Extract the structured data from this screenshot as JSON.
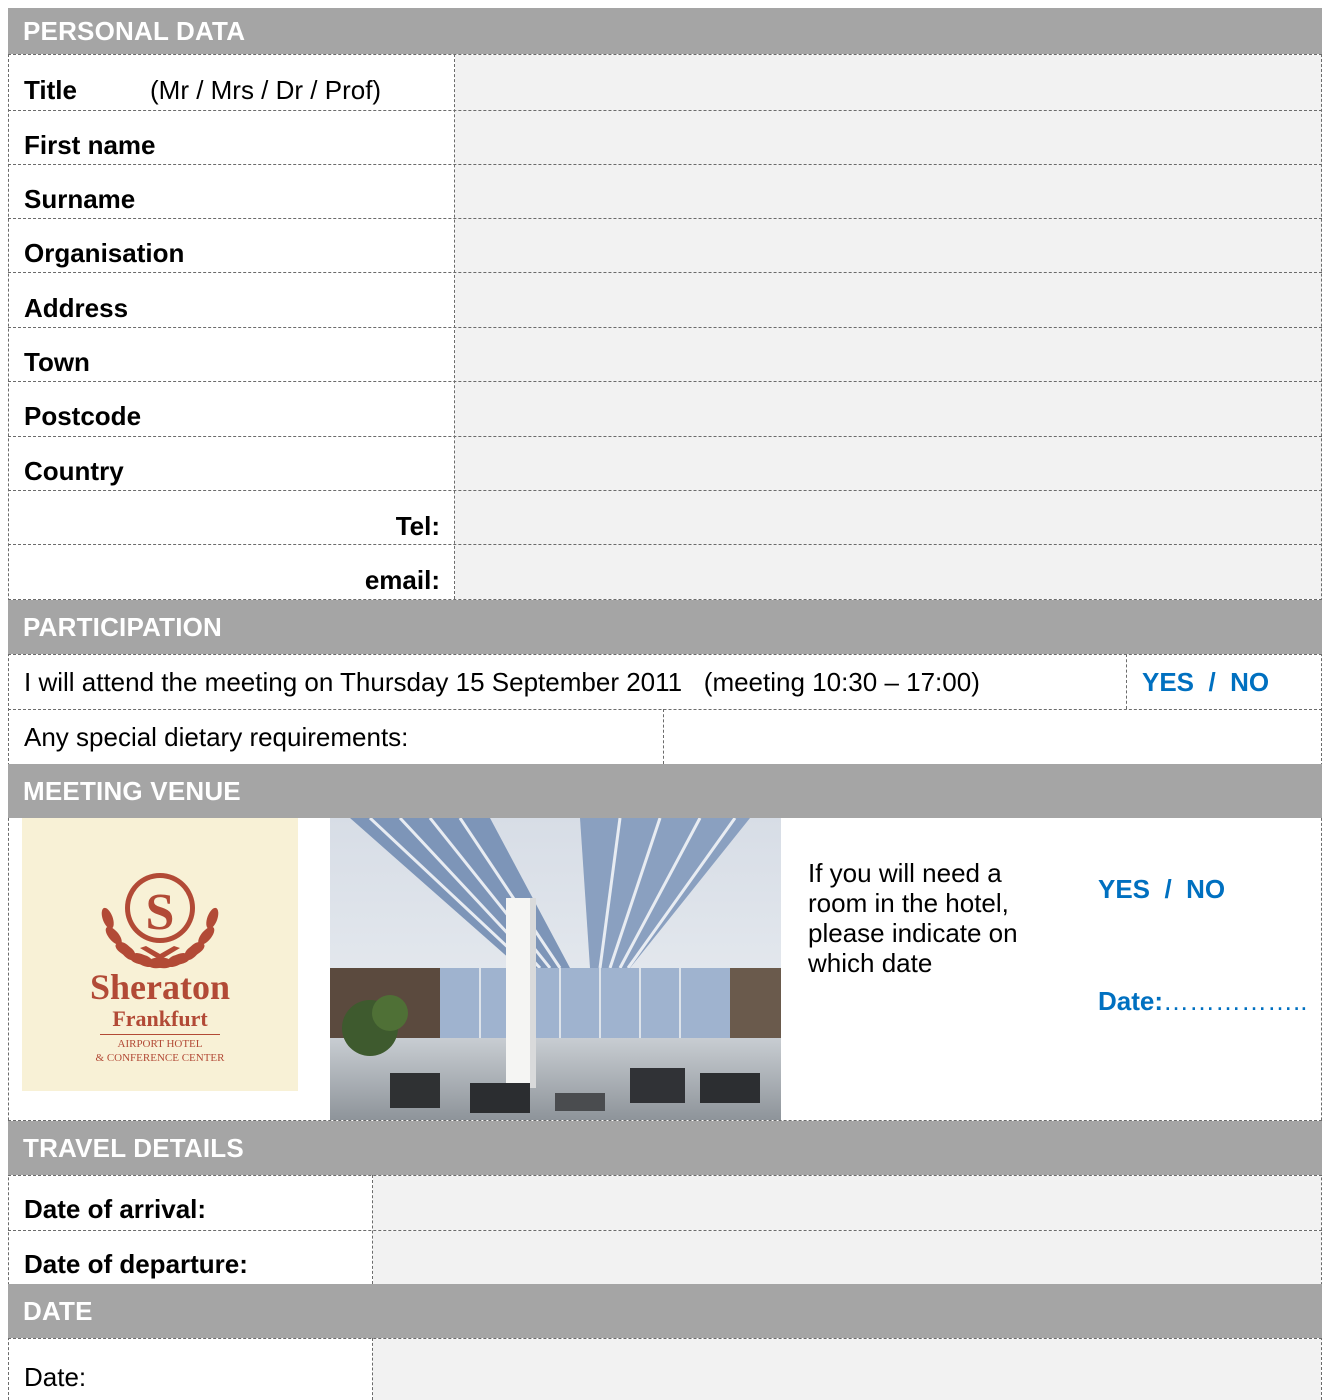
{
  "personal": {
    "header": "PERSONAL DATA",
    "title_label": "Title",
    "title_hint": "(Mr / Mrs / Dr / Prof)",
    "fields": [
      "First name",
      "Surname",
      "Organisation",
      "Address",
      "Town",
      "Postcode",
      "Country"
    ],
    "tel_label": "Tel:",
    "email_label": "email:"
  },
  "participation": {
    "header": "PARTICIPATION",
    "attend_text": "I will attend the meeting on Thursday 15 September 2011   (meeting 10:30 – 17:00)",
    "yes_no": "YES  /  NO",
    "dietary_label": "Any special dietary requirements:"
  },
  "venue": {
    "header": "MEETING VENUE",
    "logo": {
      "name": "Sheraton",
      "city": "Frankfurt",
      "line1": "AIRPORT HOTEL",
      "line2": "& CONFERENCE CENTER",
      "letter": "S"
    },
    "room_text": "If you will need a room in the hotel, please indicate on which date",
    "yes_no": "YES  /  NO",
    "date_label": "Date:",
    "date_dots": "……………..",
    "colors": {
      "logo_bg": "#f8f1d6",
      "logo_red": "#b24a36",
      "accent_blue": "#0070c0"
    }
  },
  "travel": {
    "header": "TRAVEL DETAILS",
    "arrival_label": "Date of arrival:",
    "departure_label": "Date of departure:"
  },
  "date_section": {
    "header": "DATE",
    "date_label": "Date:"
  }
}
